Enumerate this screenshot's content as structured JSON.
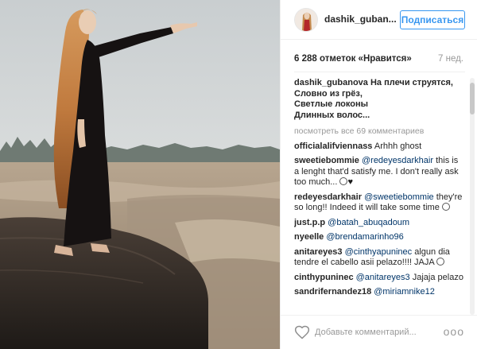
{
  "post": {
    "username": "dashik_guban...",
    "follow_label": "Подписаться",
    "likes": "6 288 отметок «Нравится»",
    "time_ago": "7 нед.",
    "caption": {
      "username": "dashik_gubanova",
      "line1": "На плечи струятся,",
      "line2": "Словно из грёз,",
      "line3": "Светлые локоны",
      "line4": "Длинных волос..."
    },
    "view_all": "посмотреть все 69 комментариев",
    "comments": [
      {
        "user": "officialalifviennass",
        "mention": "",
        "text": "Arhhh ghost"
      },
      {
        "user": "sweetiebommie",
        "mention": "@redeyesdarkhair",
        "text": "this is a lenght that'd satisfy me. I don't really ask too much..."
      },
      {
        "user": "redeyesdarkhair",
        "mention": "@sweetiebommie",
        "text": "they're so long!! Indeed it will take some time"
      },
      {
        "user": "just.p.p",
        "mention": "@batah_abuqadoum",
        "text": ""
      },
      {
        "user": "nyeelle",
        "mention": "@brendamarinho96",
        "text": ""
      },
      {
        "user": "anitareyes3",
        "mention": "@cinthyapuninec",
        "text": "algun dia tendre el cabello asii pelazo!!!! JAJA"
      },
      {
        "user": "cinthypuninec",
        "mention": "@anitareyes3",
        "text": "Jajaja pelazo"
      },
      {
        "user": "sandrifernandez18",
        "mention": "@miriamnike12",
        "text": ""
      }
    ],
    "add_comment_placeholder": "Добавьте комментарий...",
    "more_label": "ooo"
  },
  "icons": {
    "like": "heart-outline-icon",
    "emoji": "smiley-icon",
    "broken_heart": "broken-heart-icon"
  },
  "colors": {
    "accent": "#3897f0",
    "mention": "#003569",
    "muted": "#999999"
  }
}
